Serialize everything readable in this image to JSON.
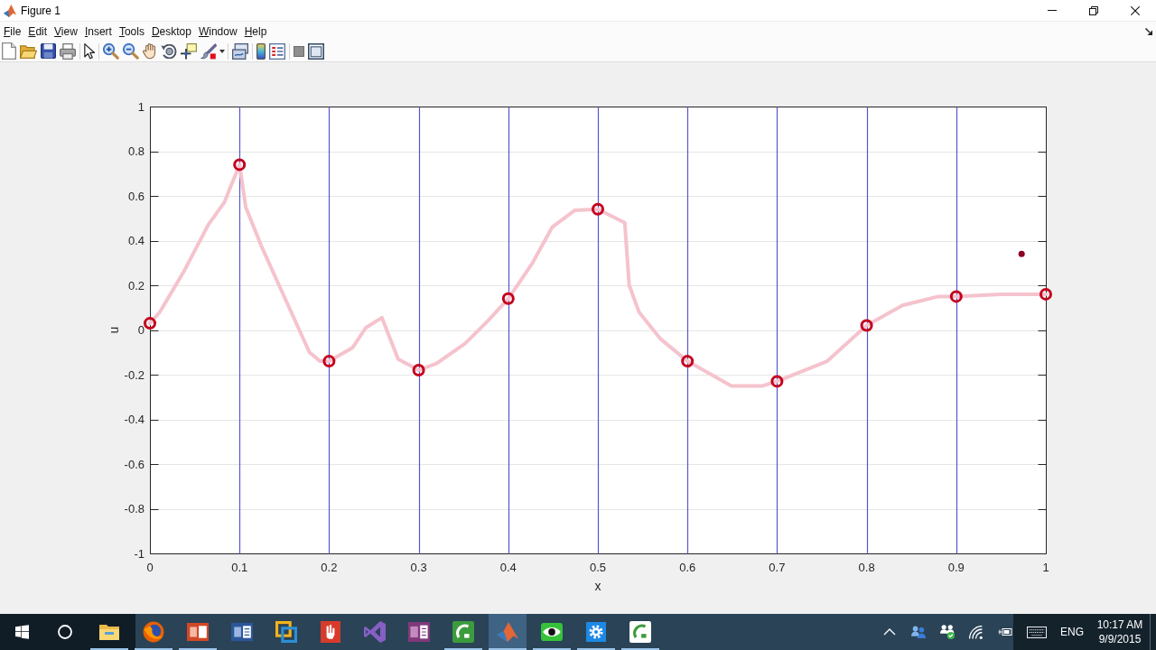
{
  "window": {
    "title": "Figure 1",
    "controls": [
      {
        "kind": "minimize"
      },
      {
        "kind": "restore"
      },
      {
        "kind": "close"
      }
    ]
  },
  "menu_bar": {
    "items": [
      "File",
      "Edit",
      "View",
      "Insert",
      "Tools",
      "Desktop",
      "Window",
      "Help"
    ],
    "tools": [
      {
        "kind": "dock"
      }
    ]
  },
  "toolbar": {
    "groups": [
      {
        "tools": [
          {
            "kind": "new"
          },
          {
            "kind": "open"
          },
          {
            "kind": "save"
          },
          {
            "kind": "print"
          }
        ]
      },
      {
        "tools": [
          {
            "kind": "pointer"
          }
        ]
      },
      {
        "tools": [
          {
            "kind": "zoom-in"
          },
          {
            "kind": "zoom-out"
          },
          {
            "kind": "pan"
          },
          {
            "kind": "rotate"
          },
          {
            "kind": "data-cursor"
          },
          {
            "kind": "brush"
          },
          {
            "kind": "caret"
          }
        ]
      },
      {
        "tools": [
          {
            "kind": "link"
          }
        ]
      },
      {
        "tools": [
          {
            "kind": "colorbar"
          },
          {
            "kind": "legend"
          }
        ]
      },
      {
        "tools": [
          {
            "kind": "hide-tools"
          },
          {
            "kind": "show-tools"
          }
        ]
      }
    ]
  },
  "figure": {
    "axes": {
      "chart_data": {
        "type": "line",
        "xlabel": "x",
        "ylabel": "u",
        "x": [
          0,
          0.011,
          0.039,
          0.065,
          0.083,
          0.1,
          0.107,
          0.125,
          0.152,
          0.178,
          0.19,
          0.2,
          0.226,
          0.241,
          0.259,
          0.277,
          0.3,
          0.32,
          0.352,
          0.377,
          0.4,
          0.427,
          0.449,
          0.474,
          0.5,
          0.53,
          0.535,
          0.546,
          0.57,
          0.6,
          0.649,
          0.684,
          0.7,
          0.756,
          0.8,
          0.84,
          0.88,
          0.9,
          0.95,
          0.973,
          1
        ],
        "series": [
          {
            "color": "#f5c3cd",
            "values": [
              0.03,
              0.08,
              0.27,
              0.47,
              0.57,
              0.74,
              0.55,
              0.37,
              0.13,
              -0.1,
              -0.14,
              -0.14,
              -0.08,
              0.01,
              0.055,
              -0.13,
              -0.18,
              -0.15,
              -0.06,
              0.04,
              0.14,
              0.3,
              0.46,
              0.535,
              0.54,
              0.48,
              0.2,
              0.08,
              -0.04,
              -0.14,
              -0.25,
              -0.25,
              -0.23,
              -0.14,
              0.02,
              0.11,
              0.15,
              0.15,
              0.16,
              0.16,
              0.16
            ]
          },
          {
            "type": "scatter",
            "marker": "circle",
            "color": "#c4001c",
            "values": [
              0.03,
              null,
              null,
              null,
              null,
              0.74,
              null,
              null,
              null,
              null,
              null,
              -0.14,
              null,
              null,
              null,
              null,
              -0.18,
              null,
              null,
              null,
              0.14,
              null,
              null,
              null,
              0.54,
              null,
              null,
              null,
              null,
              -0.14,
              null,
              null,
              -0.23,
              null,
              0.02,
              null,
              null,
              0.15,
              null,
              null,
              0.16
            ]
          },
          {
            "type": "scatter",
            "color": "#8b0024",
            "values": [
              null,
              null,
              null,
              null,
              null,
              null,
              null,
              null,
              null,
              null,
              null,
              null,
              null,
              null,
              null,
              null,
              null,
              null,
              null,
              null,
              null,
              null,
              null,
              null,
              null,
              null,
              null,
              null,
              null,
              null,
              null,
              null,
              null,
              null,
              null,
              null,
              null,
              null,
              null,
              0.34,
              null
            ]
          }
        ],
        "xlim": [
          0,
          1
        ],
        "ylim": [
          -1,
          1
        ],
        "xticks": [
          0,
          0.1,
          0.2,
          0.3,
          0.4,
          0.5,
          0.6,
          0.7,
          0.8,
          0.9,
          1
        ],
        "yticks": [
          -1,
          -0.8,
          -0.6,
          -0.4,
          -0.2,
          0,
          0.2,
          0.4,
          0.6,
          0.8,
          1
        ],
        "grid": true,
        "ref_lines": [
          {
            "axis": "x",
            "value": 0.1,
            "color": "#5656d2"
          },
          {
            "axis": "x",
            "value": 0.2,
            "color": "#5656d2"
          },
          {
            "axis": "x",
            "value": 0.3,
            "color": "#5656d2"
          },
          {
            "axis": "x",
            "value": 0.4,
            "color": "#5656d2"
          },
          {
            "axis": "x",
            "value": 0.5,
            "color": "#5656d2"
          },
          {
            "axis": "x",
            "value": 0.6,
            "color": "#5656d2"
          },
          {
            "axis": "x",
            "value": 0.7,
            "color": "#5656d2"
          },
          {
            "axis": "x",
            "value": 0.8,
            "color": "#5656d2"
          },
          {
            "axis": "x",
            "value": 0.9,
            "color": "#5656d2"
          }
        ]
      }
    }
  },
  "taskbar": {
    "buttons": [
      {
        "kind": "start"
      },
      {
        "kind": "search"
      }
    ],
    "apps": [
      {
        "kind": "folder",
        "running": true,
        "selected": false
      },
      {
        "kind": "globe",
        "running": true,
        "selected": false
      },
      {
        "kind": "slides",
        "running": true,
        "selected": false
      },
      {
        "kind": "document",
        "running": false,
        "selected": false
      },
      {
        "kind": "squares",
        "running": false,
        "selected": false
      },
      {
        "kind": "hand-tile",
        "running": false,
        "selected": false
      },
      {
        "kind": "infinity",
        "running": false,
        "selected": false
      },
      {
        "kind": "notebook",
        "running": false,
        "selected": false
      },
      {
        "kind": "arc-tile",
        "running": true,
        "selected": false
      },
      {
        "kind": "peak",
        "running": true,
        "selected": true
      },
      {
        "kind": "eye",
        "running": true,
        "selected": false
      },
      {
        "kind": "gear",
        "running": true,
        "selected": false
      },
      {
        "kind": "arc-tile-light",
        "running": true,
        "selected": false
      }
    ],
    "tray": [
      {
        "kind": "chevron"
      },
      {
        "kind": "people"
      },
      {
        "kind": "people-check"
      },
      {
        "kind": "wifi"
      },
      {
        "kind": "battery"
      },
      {
        "kind": "keyboard"
      }
    ],
    "language": "ENG",
    "time": "10:17 AM",
    "date": "9/9/2015"
  }
}
